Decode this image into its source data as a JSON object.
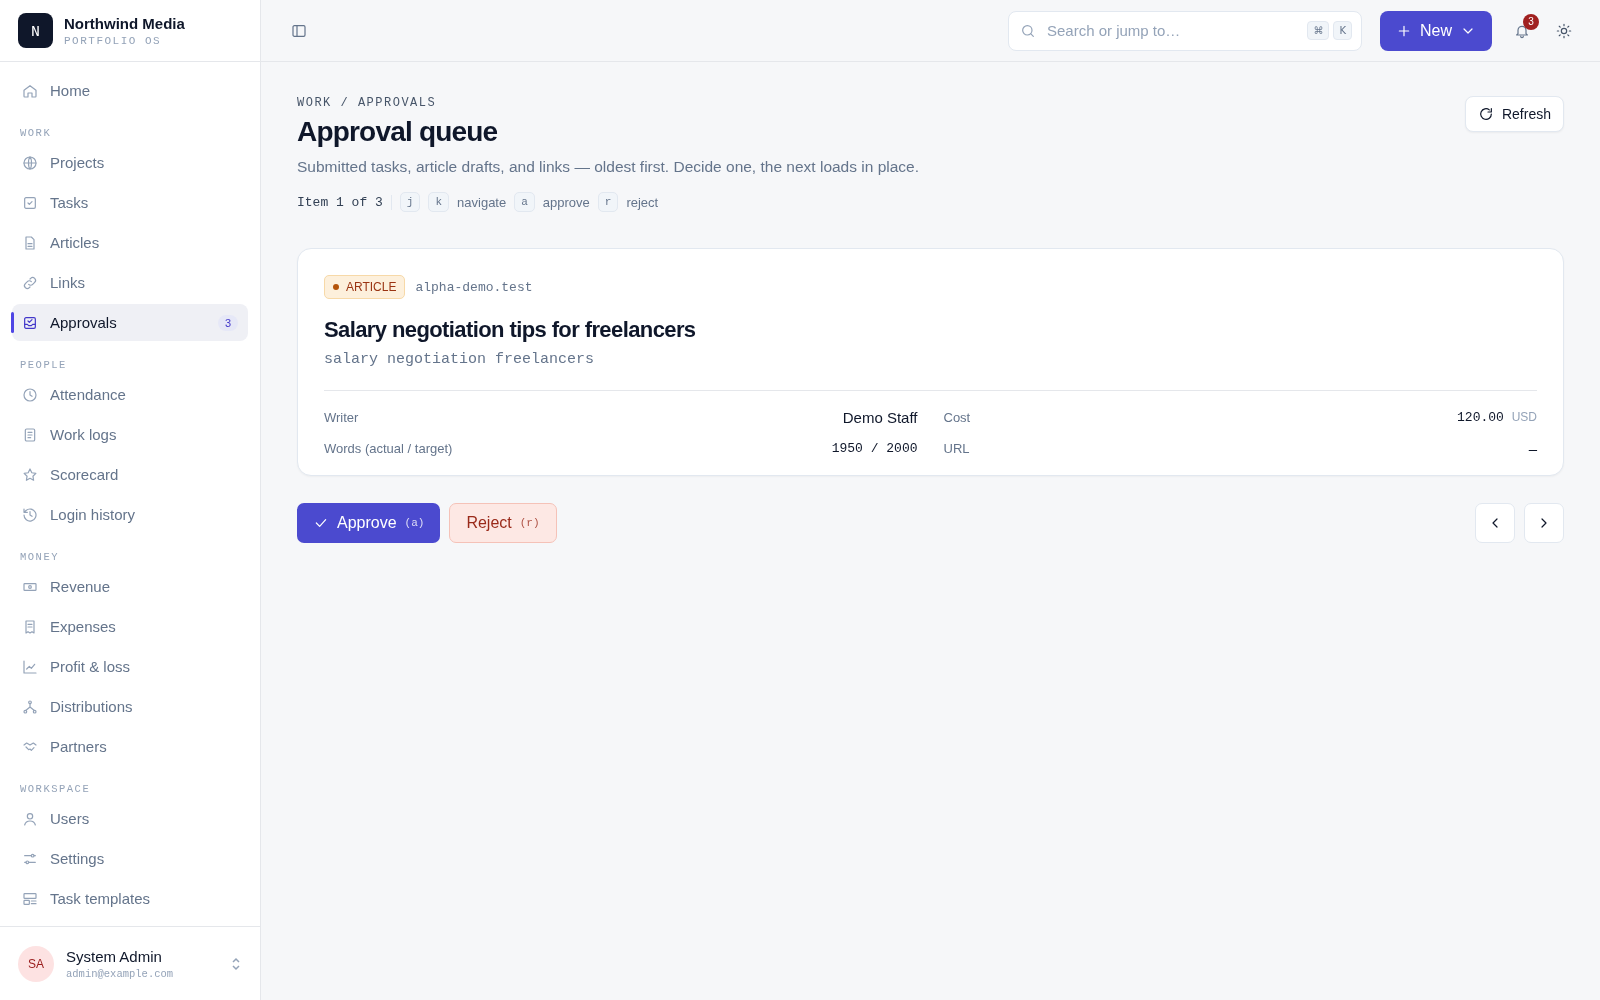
{
  "brand": {
    "logo": "N",
    "name": "Northwind Media",
    "subtitle": "PORTFOLIO OS"
  },
  "sidebar": {
    "sections": [
      {
        "items": [
          {
            "label": "Home",
            "selected": false
          }
        ]
      },
      {
        "heading": "WORK",
        "items": [
          {
            "label": "Projects",
            "selected": false
          },
          {
            "label": "Tasks",
            "selected": false
          },
          {
            "label": "Articles",
            "selected": false
          },
          {
            "label": "Links",
            "selected": false
          },
          {
            "label": "Approvals",
            "selected": true,
            "badge": "3"
          }
        ]
      },
      {
        "heading": "PEOPLE",
        "items": [
          {
            "label": "Attendance",
            "selected": false
          },
          {
            "label": "Work logs",
            "selected": false
          },
          {
            "label": "Scorecard",
            "selected": false
          },
          {
            "label": "Login history",
            "selected": false
          }
        ]
      },
      {
        "heading": "MONEY",
        "items": [
          {
            "label": "Revenue",
            "selected": false
          },
          {
            "label": "Expenses",
            "selected": false
          },
          {
            "label": "Profit & loss",
            "selected": false
          },
          {
            "label": "Distributions",
            "selected": false
          },
          {
            "label": "Partners",
            "selected": false
          }
        ]
      },
      {
        "heading": "WORKSPACE",
        "items": [
          {
            "label": "Users",
            "selected": false
          },
          {
            "label": "Settings",
            "selected": false
          },
          {
            "label": "Task templates",
            "selected": false
          }
        ]
      }
    ]
  },
  "user": {
    "initials": "SA",
    "name": "System Admin",
    "email": "admin@example.com"
  },
  "topbar": {
    "search": {
      "placeholder": "Search or jump to…",
      "keys": [
        "⌘",
        "K"
      ]
    },
    "new_button": "New",
    "notifications": "3"
  },
  "breadcrumb": "WORK / APPROVALS",
  "title": "Approval queue",
  "refresh": "Refresh",
  "description": "Submitted tasks, article drafts, and links — oldest first. Decide one, the next loads in place.",
  "position": "Item 1 of 3",
  "shortcuts": [
    {
      "keys": [
        "j",
        "k"
      ],
      "label": "navigate"
    },
    {
      "keys": [
        "a"
      ],
      "label": "approve"
    },
    {
      "keys": [
        "r"
      ],
      "label": "reject"
    }
  ],
  "item": {
    "type": "ARTICLE",
    "color": "#b45309",
    "site": "alpha-demo.test",
    "title": "Salary negotiation tips for freelancers",
    "keywords": "salary negotiation freelancers",
    "fields": [
      {
        "label": "Writer",
        "value": "Demo Staff",
        "kind": "text"
      },
      {
        "label": "Cost",
        "value": "120.00",
        "unit": "USD",
        "kind": "mono"
      },
      {
        "label": "Words (actual / target)",
        "value": "1950 / 2000",
        "kind": "mono"
      },
      {
        "label": "URL",
        "value": "–",
        "kind": "text"
      }
    ]
  },
  "actions": {
    "approve": {
      "label": "Approve",
      "key": "(a)"
    },
    "reject": {
      "label": "Reject",
      "key": "(r)"
    }
  }
}
